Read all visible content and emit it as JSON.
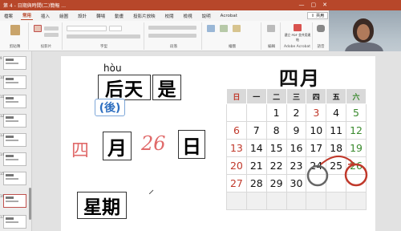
{
  "window": {
    "title": "第 4 - 日期與時間(二)簡報 ...",
    "controls": [
      "—",
      "▢",
      "✕"
    ]
  },
  "menu": {
    "tabs": [
      "檔案",
      "常用",
      "插入",
      "繪圖",
      "設計",
      "轉場",
      "動畫",
      "投影片放映",
      "校閱",
      "檢視",
      "說明",
      "Acrobat"
    ],
    "active_index": 1,
    "share_label": "共用"
  },
  "ribbon": {
    "groups": [
      "剪貼簿",
      "投影片",
      "字型",
      "段落",
      "繪圖",
      "編輯",
      "Adobe Acrobat",
      "語音"
    ],
    "acrobat_label": "建立 PDF 並共用連結"
  },
  "slide_content": {
    "pinyin": "hòu",
    "word_houtian": "后天",
    "word_shi": "是",
    "word_trad": "(後)",
    "word_yue": "月",
    "word_ri": "日",
    "word_xingqi": "星期",
    "hand_si": "四",
    "hand_26": "26"
  },
  "calendar": {
    "title": "四月",
    "headers": [
      "日",
      "一",
      "二",
      "三",
      "四",
      "五",
      "六"
    ],
    "weeks": [
      [
        "",
        "",
        "1",
        "2",
        "3",
        "4",
        "5"
      ],
      [
        "6",
        "7",
        "8",
        "9",
        "10",
        "11",
        "12"
      ],
      [
        "13",
        "14",
        "15",
        "16",
        "17",
        "18",
        "19"
      ],
      [
        "20",
        "21",
        "22",
        "23",
        "24",
        "25",
        "26"
      ],
      [
        "27",
        "28",
        "29",
        "30",
        "",
        "",
        ""
      ],
      [
        "",
        "",
        "",
        "",
        "",
        "",
        ""
      ]
    ],
    "sunday_color": "#c0392b",
    "saturday_color": "#3a8a2e",
    "circled": [
      "24",
      "26"
    ]
  },
  "thumbnails": [
    "9",
    "10",
    "11",
    "12",
    "13",
    "14",
    "15",
    "16",
    "17"
  ],
  "colors": {
    "accent": "#b7472a",
    "annotation_red": "#c0392b",
    "annotation_gray": "#666666"
  }
}
